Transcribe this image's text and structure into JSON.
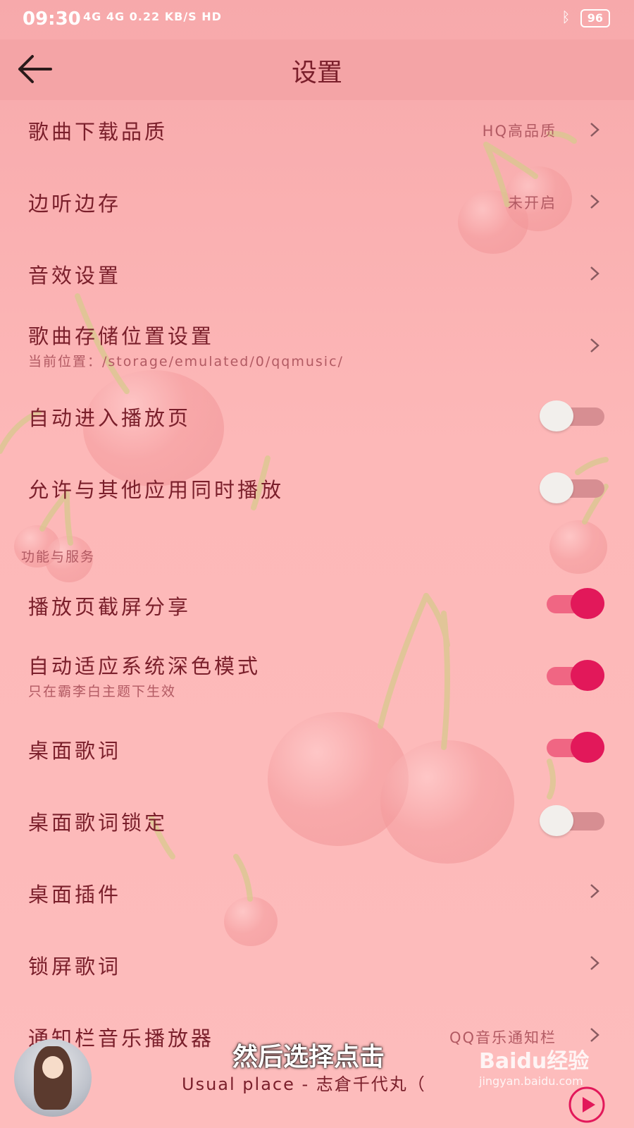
{
  "status_bar": {
    "time": "09:30",
    "network": "4G 4G 0.22 KB/S HD",
    "battery": "96"
  },
  "header": {
    "title": "设置"
  },
  "settings": [
    {
      "label": "歌曲下载品质",
      "value": "HQ高品质"
    },
    {
      "label": "边听边存",
      "value": "未开启"
    },
    {
      "label": "音效设置"
    },
    {
      "label": "歌曲存储位置设置",
      "subtitle": "当前位置：/storage/emulated/0/qqmusic/"
    },
    {
      "label": "自动进入播放页",
      "toggle": false
    },
    {
      "label": "允许与其他应用同时播放",
      "toggle": false
    }
  ],
  "section_header": "功能与服务",
  "features": [
    {
      "label": "播放页截屏分享",
      "toggle": true
    },
    {
      "label": "自动适应系统深色模式",
      "subtitle": "只在霸李白主题下生效",
      "toggle": true
    },
    {
      "label": "桌面歌词",
      "toggle": true
    },
    {
      "label": "桌面歌词锁定",
      "toggle": false
    },
    {
      "label": "桌面插件"
    },
    {
      "label": "锁屏歌词"
    },
    {
      "label": "通知栏音乐播放器",
      "value": "QQ音乐通知栏"
    }
  ],
  "player": {
    "now_playing": "Usual place - 志倉千代丸（"
  },
  "caption": "然后选择点击",
  "watermark": {
    "main": "Baidu经验",
    "sub": "jingyan.baidu.com"
  },
  "colors": {
    "accent": "#e2185a",
    "title_bar": "#f4a4a6",
    "text": "#7a1f2b"
  }
}
